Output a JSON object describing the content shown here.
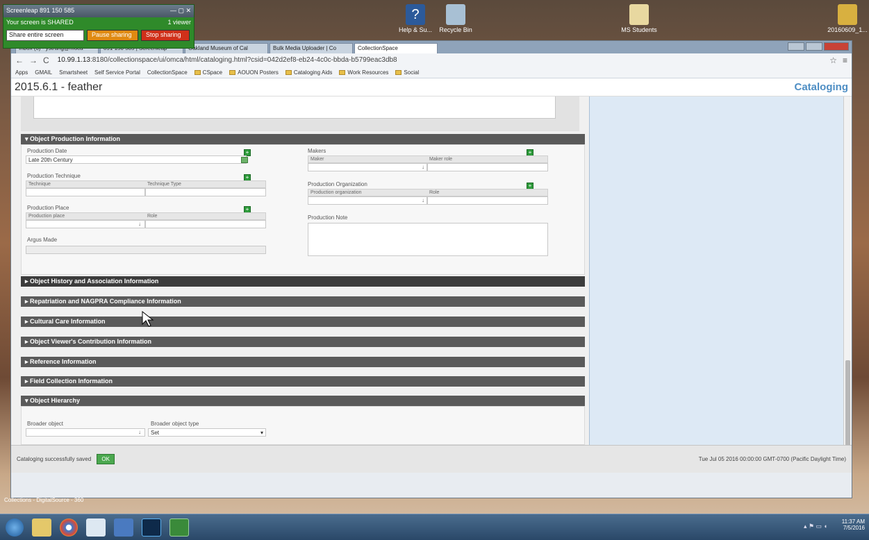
{
  "screenshare": {
    "title": "Screenleap 891 150 585",
    "status": "Your screen is SHARED",
    "viewers": "1 viewer",
    "mode_select": "Share entire screen",
    "pause_label": "Pause sharing",
    "stop_label": "Stop sharing"
  },
  "desktop": {
    "icons": [
      {
        "label": "Help & Su...",
        "name": "help-support-icon"
      },
      {
        "label": "Recycle Bin",
        "name": "recycle-bin-icon"
      },
      {
        "label": "MS Students",
        "name": "folder-icon"
      },
      {
        "label": "20160609_1...",
        "name": "file-icon"
      }
    ],
    "bottom_text": "Collections - DigitalSource - 360"
  },
  "browser": {
    "tabs": [
      "Inbox (3) - ystrang@moca",
      "891 150 585 | Screenleap",
      "Oakland Museum of Cal",
      "Bulk Media Uploader | Co",
      "CollectionSpace"
    ],
    "url_host": "10.99.1.13",
    "url_rest": ":8180/collectionspace/ui/omca/html/cataloging.html?csid=042d2ef8-eb24-4c0c-bbda-b5799eac3db8",
    "bookmarks": [
      "Apps",
      "GMAIL",
      "Smartsheet",
      "Self Service Portal",
      "CollectionSpace",
      "CSpace",
      "AOUON Posters",
      "Cataloging Aids",
      "Work Resources",
      "Social"
    ]
  },
  "page": {
    "object_title": "2015.6.1 - feather",
    "app_title": "Cataloging"
  },
  "production": {
    "header": "▾ Object Production Information",
    "date_label": "Production Date",
    "date_value": "Late 20th Century",
    "technique_label": "Production Technique",
    "technique_col": "Technique",
    "technique_type_col": "Technique Type",
    "place_label": "Production Place",
    "place_col": "Production place",
    "role_col": "Role",
    "argus_label": "Argus Made",
    "makers_label": "Makers",
    "maker_col": "Maker",
    "maker_role_col": "Maker role",
    "org_label": "Production Organization",
    "org_col": "Production organization",
    "org_role_col": "Role",
    "note_label": "Production Note"
  },
  "sections": [
    "▸ Object History and Association Information",
    "▸ Repatriation and NAGPRA Compliance Information",
    "▸ Cultural Care Information",
    "▸ Object Viewer's Contribution Information",
    "▸ Reference Information",
    "▸ Field Collection Information"
  ],
  "hierarchy": {
    "header": "▾ Object Hierarchy",
    "broader_label": "Broader object",
    "broader_type_label": "Broader object type",
    "broader_type_value": "Set"
  },
  "footer": {
    "saved_text": "Cataloging successfully saved",
    "ok_label": "OK",
    "timestamp": "Tue Jul 05 2016 00:00:00 GMT-0700 (Pacific Daylight Time)"
  },
  "taskbar": {
    "time": "11:37 AM",
    "date": "7/5/2016"
  }
}
